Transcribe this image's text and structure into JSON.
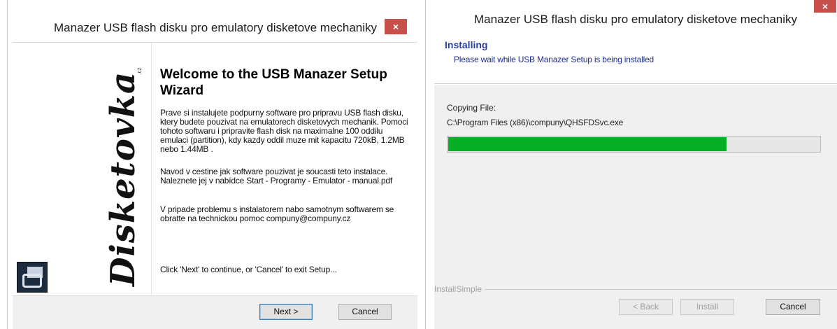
{
  "left_window": {
    "title": "Manazer USB flash disku pro emulatory disketove mechaniky",
    "close_glyph": "×",
    "banner_logo": "Disketovka",
    "banner_logo_small": ".cz",
    "welcome_title": "Welcome to the USB Manazer Setup Wizard",
    "paragraph1": "Prave si instalujete podpurny software pro pripravu USB flash disku, ktery budete pouzivat na emulatorech disketovych mechanik. Pomoci tohoto softwaru i pripravite flash disk na maximalne 100 oddilu emulaci (partition), kdy kazdy oddil muze mit kapacitu 720kB, 1.2MB nebo 1.44MB .",
    "paragraph2": "Navod v cestine jak software pouzivat je soucasti teto instalace. Naleznete jej v nabídce Start - Programy - Emulator - manual.pdf",
    "paragraph3": "V pripade problemu s instalatorem nabo samotnym softwarem se obratte na technickou pomoc compuny@compuny.cz",
    "paragraph4": "Click 'Next' to continue, or 'Cancel' to exit Setup...",
    "next_label": "Next >",
    "cancel_label": "Cancel"
  },
  "right_window": {
    "title": "Manazer USB flash disku pro emulatory disketove mechaniky",
    "close_glyph": "×",
    "header_title": "Installing",
    "header_subtitle": "Please wait while USB Manazer Setup is being installed",
    "copy_label": "Copying File:",
    "copy_path": "C:\\Program Files (x86)\\compuny\\QHSFDSvc.exe",
    "progress_percent": 75,
    "brand_label": "InstallSimple",
    "back_label": "< Back",
    "install_label": "Install",
    "cancel_label": "Cancel"
  },
  "colors": {
    "close_button": "#c7504b",
    "progress_fill": "#06b025",
    "header_title": "#2b3fa0"
  }
}
